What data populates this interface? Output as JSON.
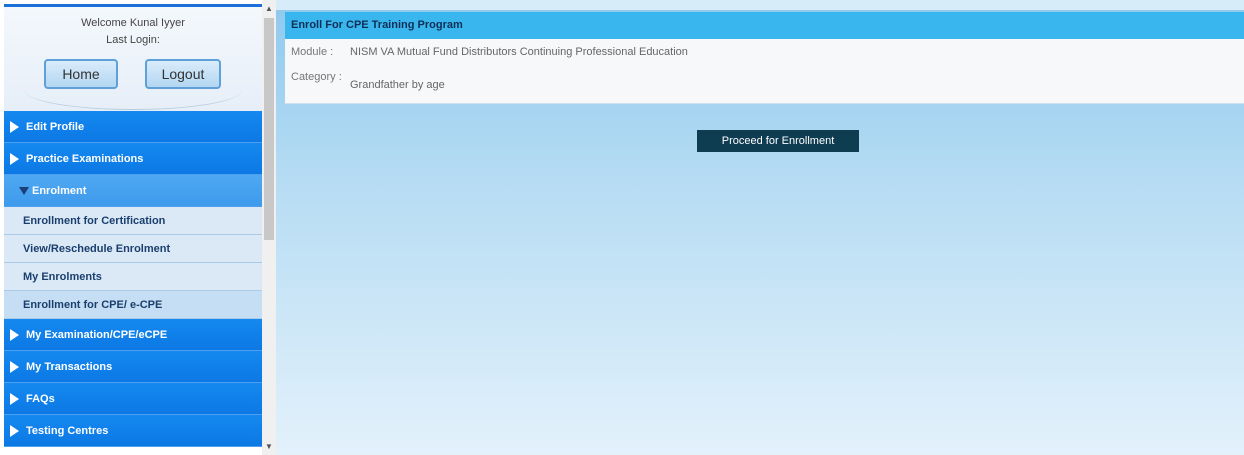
{
  "sidebar": {
    "welcome": "Welcome Kunal Iyyer",
    "last_login": "Last Login:",
    "home_label": "Home",
    "logout_label": "Logout",
    "menu": [
      {
        "label": "Edit Profile"
      },
      {
        "label": "Practice Examinations"
      },
      {
        "label": "Enrolment"
      },
      {
        "label": "Enrollment for Certification"
      },
      {
        "label": "View/Reschedule Enrolment"
      },
      {
        "label": "My Enrolments"
      },
      {
        "label": "Enrollment for CPE/ e-CPE"
      },
      {
        "label": "My Examination/CPE/eCPE"
      },
      {
        "label": "My Transactions"
      },
      {
        "label": "FAQs"
      },
      {
        "label": "Testing Centres"
      }
    ]
  },
  "scrollbar": {
    "up": "▲",
    "down": "▼"
  },
  "main": {
    "panel_title": "Enroll For CPE Training Program",
    "module_label": "Module :",
    "module_value": "NISM VA Mutual Fund Distributors Continuing Professional Education",
    "category_label": "Category :",
    "category_value": "Grandfather by age",
    "proceed_label": "Proceed for Enrollment"
  },
  "colors": {
    "menu_blue": "#0c78e4",
    "header_blue": "#3ab6ef",
    "button_dark": "#0e3d52"
  }
}
